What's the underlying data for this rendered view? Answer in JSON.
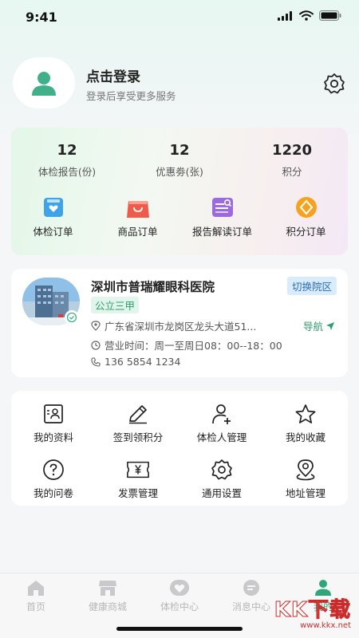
{
  "status_bar": {
    "time": "9:41"
  },
  "profile": {
    "title": "点击登录",
    "subtitle": "登录后享受更多服务"
  },
  "stats": [
    {
      "value": "12",
      "label": "体检报告(份)"
    },
    {
      "value": "12",
      "label": "优惠劵(张)"
    },
    {
      "value": "1220",
      "label": "积分"
    }
  ],
  "orders": [
    {
      "label": "体检订单",
      "icon": "report-order-icon",
      "color": "#3fa3e8"
    },
    {
      "label": "商品订单",
      "icon": "shopping-bag-icon",
      "color": "#ef5b4b"
    },
    {
      "label": "报告解读订单",
      "icon": "report-interpret-icon",
      "color": "#9b6ae0"
    },
    {
      "label": "积分订单",
      "icon": "points-order-icon",
      "color": "#f7a21f"
    }
  ],
  "hospital": {
    "name": "深圳市普瑞耀眼科医院",
    "switch_label": "切换院区",
    "level": "公立三甲",
    "address": "广东省深圳市龙岗区龙头大道51...",
    "nav_label": "导航",
    "hours": "营业时间：周一至周日08：00--18：00",
    "phone": "136 5854 1234"
  },
  "tools": [
    {
      "label": "我的资料",
      "icon": "profile-card-icon"
    },
    {
      "label": "签到领积分",
      "icon": "pencil-icon"
    },
    {
      "label": "体检人管理",
      "icon": "add-person-icon"
    },
    {
      "label": "我的收藏",
      "icon": "star-icon"
    },
    {
      "label": "我的问卷",
      "icon": "question-icon"
    },
    {
      "label": "发票管理",
      "icon": "invoice-icon"
    },
    {
      "label": "通用设置",
      "icon": "gear-icon"
    },
    {
      "label": "地址管理",
      "icon": "location-icon"
    }
  ],
  "tabbar": [
    {
      "label": "首页",
      "icon": "home-icon",
      "active": false
    },
    {
      "label": "健康商城",
      "icon": "store-icon",
      "active": false
    },
    {
      "label": "体检中心",
      "icon": "heart-icon",
      "active": false
    },
    {
      "label": "消息中心",
      "icon": "message-icon",
      "active": false
    },
    {
      "label": "我的",
      "icon": "user-icon",
      "active": true
    }
  ],
  "watermark": {
    "main": "KK下载",
    "sub": "www.kkx.net"
  },
  "colors": {
    "accent": "#2fa67a",
    "link_blue": "#2a6db5"
  }
}
